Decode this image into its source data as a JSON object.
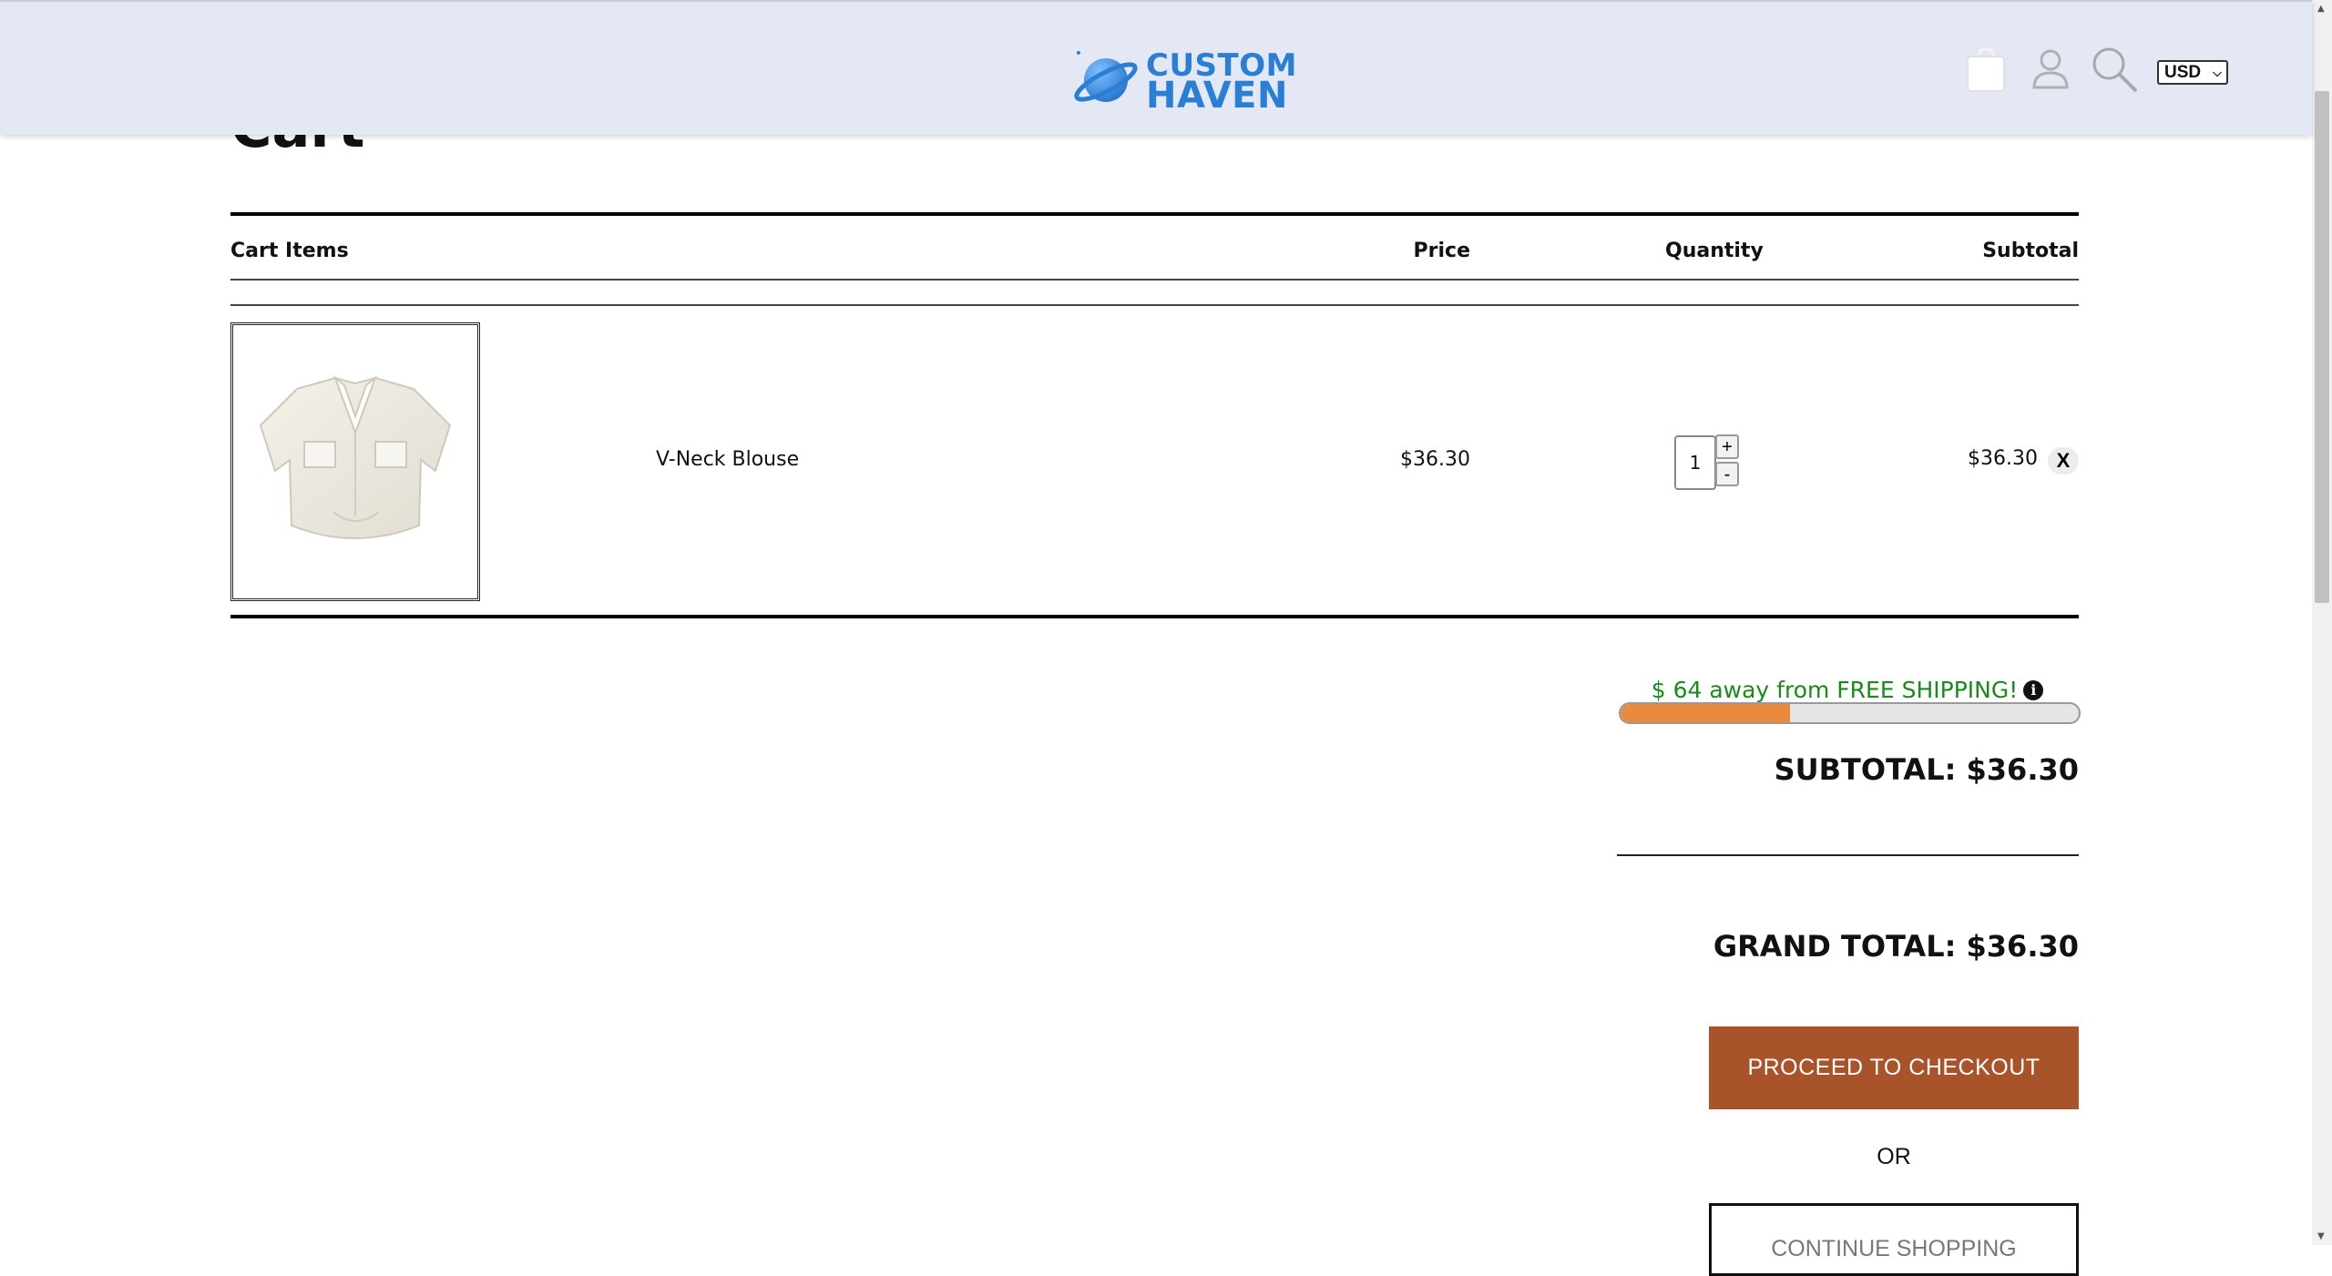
{
  "header": {
    "logo_line1": "CUSTOM",
    "logo_line2": "HAVEN",
    "currency": "USD",
    "icons": [
      "shopping-bag-icon",
      "user-icon",
      "search-icon"
    ]
  },
  "page": {
    "title": "Cart"
  },
  "cart": {
    "columns": {
      "items": "Cart Items",
      "price": "Price",
      "quantity": "Quantity",
      "subtotal": "Subtotal"
    },
    "items": [
      {
        "name": "V-Neck Blouse",
        "price": "$36.30",
        "quantity": "1",
        "subtotal": "$36.30",
        "remove_label": "X"
      }
    ],
    "qty_plus": "+",
    "qty_minus": "-"
  },
  "totals": {
    "shipping_message": "$ 64 away from FREE SHIPPING!",
    "shipping_progress": 0.37,
    "subtotal_label": "SUBTOTAL: $36.30",
    "grand_total_label": "GRAND TOTAL: $36.30",
    "checkout_label": "PROCEED TO CHECKOUT",
    "or_label": "OR",
    "continue_label": "CONTINUE SHOPPING"
  },
  "colors": {
    "header_bg": "#e4e7f4",
    "brand_blue": "#2a7fd4",
    "checkout_btn": "#a9532a",
    "progress_fill": "#ea8a3c",
    "shipping_text": "#1a8a1a"
  }
}
